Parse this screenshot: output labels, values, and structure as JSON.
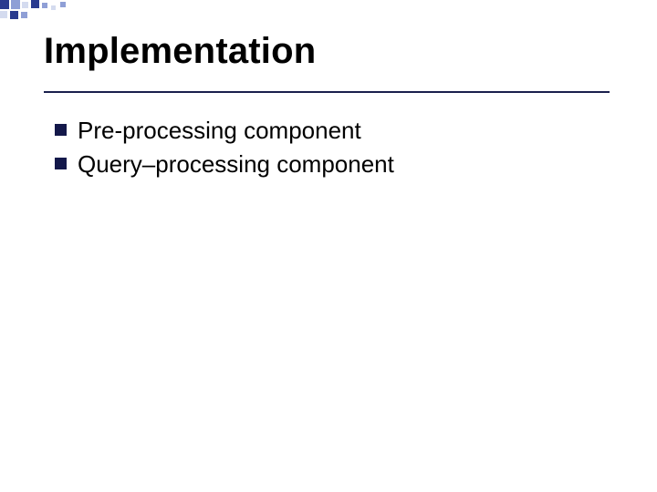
{
  "slide": {
    "title": "Implementation",
    "bullets": [
      "Pre-processing component",
      "Query–processing component"
    ]
  }
}
